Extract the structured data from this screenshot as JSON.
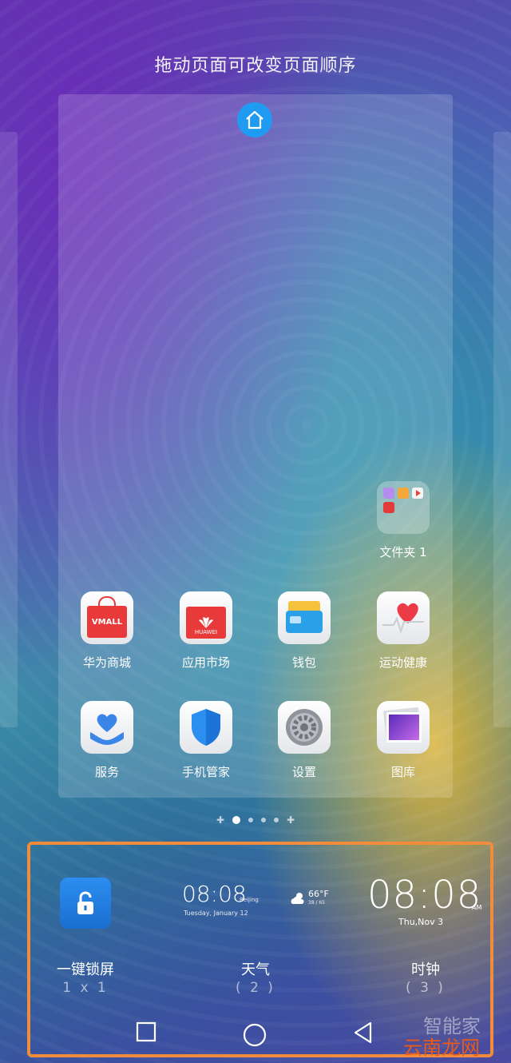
{
  "header": {
    "title": "拖动页面可改变页面顺序"
  },
  "folder": {
    "label": "文件夹 1"
  },
  "apps": [
    {
      "label": "华为商城",
      "icon": "vmall-icon",
      "icon_text": "VMALL"
    },
    {
      "label": "应用市场",
      "icon": "huawei-appgallery-icon",
      "icon_text": "HUAWEI"
    },
    {
      "label": "钱包",
      "icon": "wallet-icon"
    },
    {
      "label": "运动健康",
      "icon": "health-heart-icon"
    },
    {
      "label": "服务",
      "icon": "services-heart-hand-icon"
    },
    {
      "label": "手机管家",
      "icon": "phone-manager-shield-icon"
    },
    {
      "label": "设置",
      "icon": "settings-gear-icon"
    },
    {
      "label": "图库",
      "icon": "gallery-icon"
    }
  ],
  "page_indicator": {
    "pages": 4,
    "active_index": 0
  },
  "widgets": {
    "lock": {
      "name": "一键锁屏",
      "size": "1 x 1"
    },
    "weather": {
      "name": "天气",
      "count": "( 2 )",
      "time": "08:08",
      "city": "Beijing",
      "date": "Tuesday, January 12",
      "temp": "66°F",
      "range": "38 / 65"
    },
    "clock": {
      "name": "时钟",
      "count": "( 3 )",
      "time": "08:08",
      "ampm": "AM",
      "date": "Thu,Nov 3"
    }
  },
  "watermark": {
    "top": "智能家",
    "bottom": "云南龙网"
  },
  "colors": {
    "highlight_border": "#f08c3c",
    "home_button": "#1f9cf2"
  }
}
